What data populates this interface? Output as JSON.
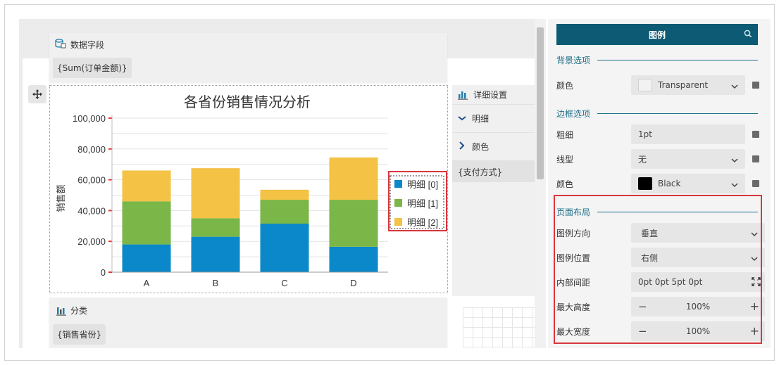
{
  "canvas": {
    "data_field": {
      "title": "数据字段",
      "chip": "{Sum(订单金额)}"
    },
    "category": {
      "title": "分类",
      "chip": "{销售省份}"
    },
    "side_menu": {
      "detail_settings": "详细设置",
      "detail": "明细",
      "color": "颜色",
      "payment_chip": "{支付方式}"
    }
  },
  "chart_data": {
    "type": "bar",
    "stacked": true,
    "title": "各省份销售情况分析",
    "ylabel": "销售额",
    "xlabel": "",
    "categories": [
      "A",
      "B",
      "C",
      "D"
    ],
    "ylim": [
      0,
      100000
    ],
    "yticks": [
      0,
      20000,
      40000,
      60000,
      80000,
      100000
    ],
    "ytick_labels": [
      "0",
      "20,000",
      "40,000",
      "60,000",
      "80,000",
      "100,000"
    ],
    "grid": true,
    "legend_position": "right",
    "series": [
      {
        "name": "明细 [0]",
        "color": "#0a88c9",
        "values": [
          18000,
          23000,
          31500,
          16500
        ]
      },
      {
        "name": "明细 [1]",
        "color": "#7ab648",
        "values": [
          28000,
          12000,
          15500,
          30500
        ]
      },
      {
        "name": "明细 [2]",
        "color": "#f4c245",
        "values": [
          20000,
          32500,
          6500,
          27500
        ]
      }
    ]
  },
  "props": {
    "header_title": "图例",
    "bg_section": "背景选项",
    "bg_color_label": "颜色",
    "bg_color_value": "Transparent",
    "border_section": "边框选项",
    "thickness_label": "粗细",
    "thickness_value": "1pt",
    "line_style_label": "线型",
    "line_style_value": "无",
    "border_color_label": "颜色",
    "border_color_value": "Black",
    "layout_section": "页面布局",
    "orientation_label": "图例方向",
    "orientation_value": "垂直",
    "position_label": "图例位置",
    "position_value": "右侧",
    "padding_label": "内部间距",
    "padding_value": "0pt 0pt 5pt 0pt",
    "max_height_label": "最大高度",
    "max_height_value": "100%",
    "max_width_label": "最大宽度",
    "max_width_value": "100%"
  },
  "colors": {
    "accent": "#0c5a73",
    "highlight": "#d9363e",
    "black_swatch": "#000000"
  }
}
